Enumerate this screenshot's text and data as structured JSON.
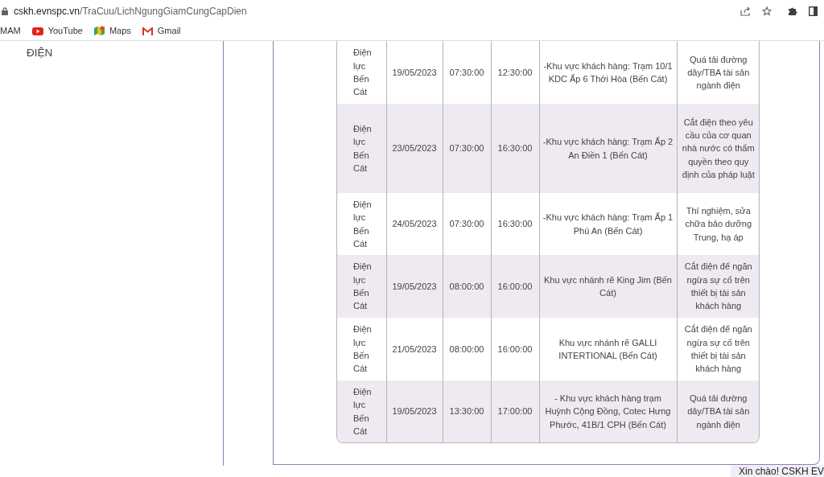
{
  "browser": {
    "url_host": "cskh.evnspc.vn",
    "url_path": "/TraCuu/LichNgungGiamCungCapDien",
    "bookmarks": [
      {
        "label": "MAM",
        "kind": "plain"
      },
      {
        "label": "YouTube",
        "kind": "youtube"
      },
      {
        "label": "Maps",
        "kind": "maps"
      },
      {
        "label": "Gmail",
        "kind": "gmail"
      }
    ]
  },
  "sidebar": {
    "text": "ĐIỆN"
  },
  "table": {
    "rows": [
      {
        "unit": "Điện lực Bến Cát",
        "date": "19/05/2023",
        "start": "07:30:00",
        "end": "12:30:00",
        "area": "-Khu vực khách hàng: Trạm 10/1 KDC Ấp 6 Thới Hòa (Bến Cát)",
        "reason": "Quá tải đường dây/TBA tài sản ngành điện"
      },
      {
        "unit": "Điện lực Bến Cát",
        "date": "23/05/2023",
        "start": "07:30:00",
        "end": "16:30:00",
        "area": "-Khu vực khách hàng: Trạm Ấp 2 An Điền 1 (Bến Cát)",
        "reason": "Cắt điện theo yêu cầu của cơ quan nhà nước có thẩm quyền theo quy định của pháp luật"
      },
      {
        "unit": "Điện lực Bến Cát",
        "date": "24/05/2023",
        "start": "07:30:00",
        "end": "16:30:00",
        "area": "-Khu vực khách hàng: Trạm Ấp 1 Phú An (Bến Cát)",
        "reason": "Thí nghiệm, sửa chữa bảo dưỡng Trung, hạ áp"
      },
      {
        "unit": "Điện lực Bến Cát",
        "date": "19/05/2023",
        "start": "08:00:00",
        "end": "16:00:00",
        "area": "Khu vực nhánh rẽ King Jim (Bến Cát)",
        "reason": "Cắt điện để ngăn ngừa sự cố trên thiết bị tài sản khách hàng"
      },
      {
        "unit": "Điện lực Bến Cát",
        "date": "21/05/2023",
        "start": "08:00:00",
        "end": "16:00:00",
        "area": "Khu vực nhánh rẽ GALLI INTERTIONAL (Bến Cát)",
        "reason": "Cắt điện để ngăn ngừa sự cố trên thiết bị tài sản khách hàng"
      },
      {
        "unit": "Điện lực Bến Cát",
        "date": "19/05/2023",
        "start": "13:30:00",
        "end": "17:00:00",
        "area": "- Khu vực khách hàng trạm Huỳnh Cộng Đồng, Cotec Hưng Phước, 41B/1 CPH (Bến Cát)",
        "reason": "Quá tải đường dây/TBA tài sản ngành điện"
      }
    ]
  },
  "chat": {
    "greeting": "Xin chào! CSKH EV"
  }
}
